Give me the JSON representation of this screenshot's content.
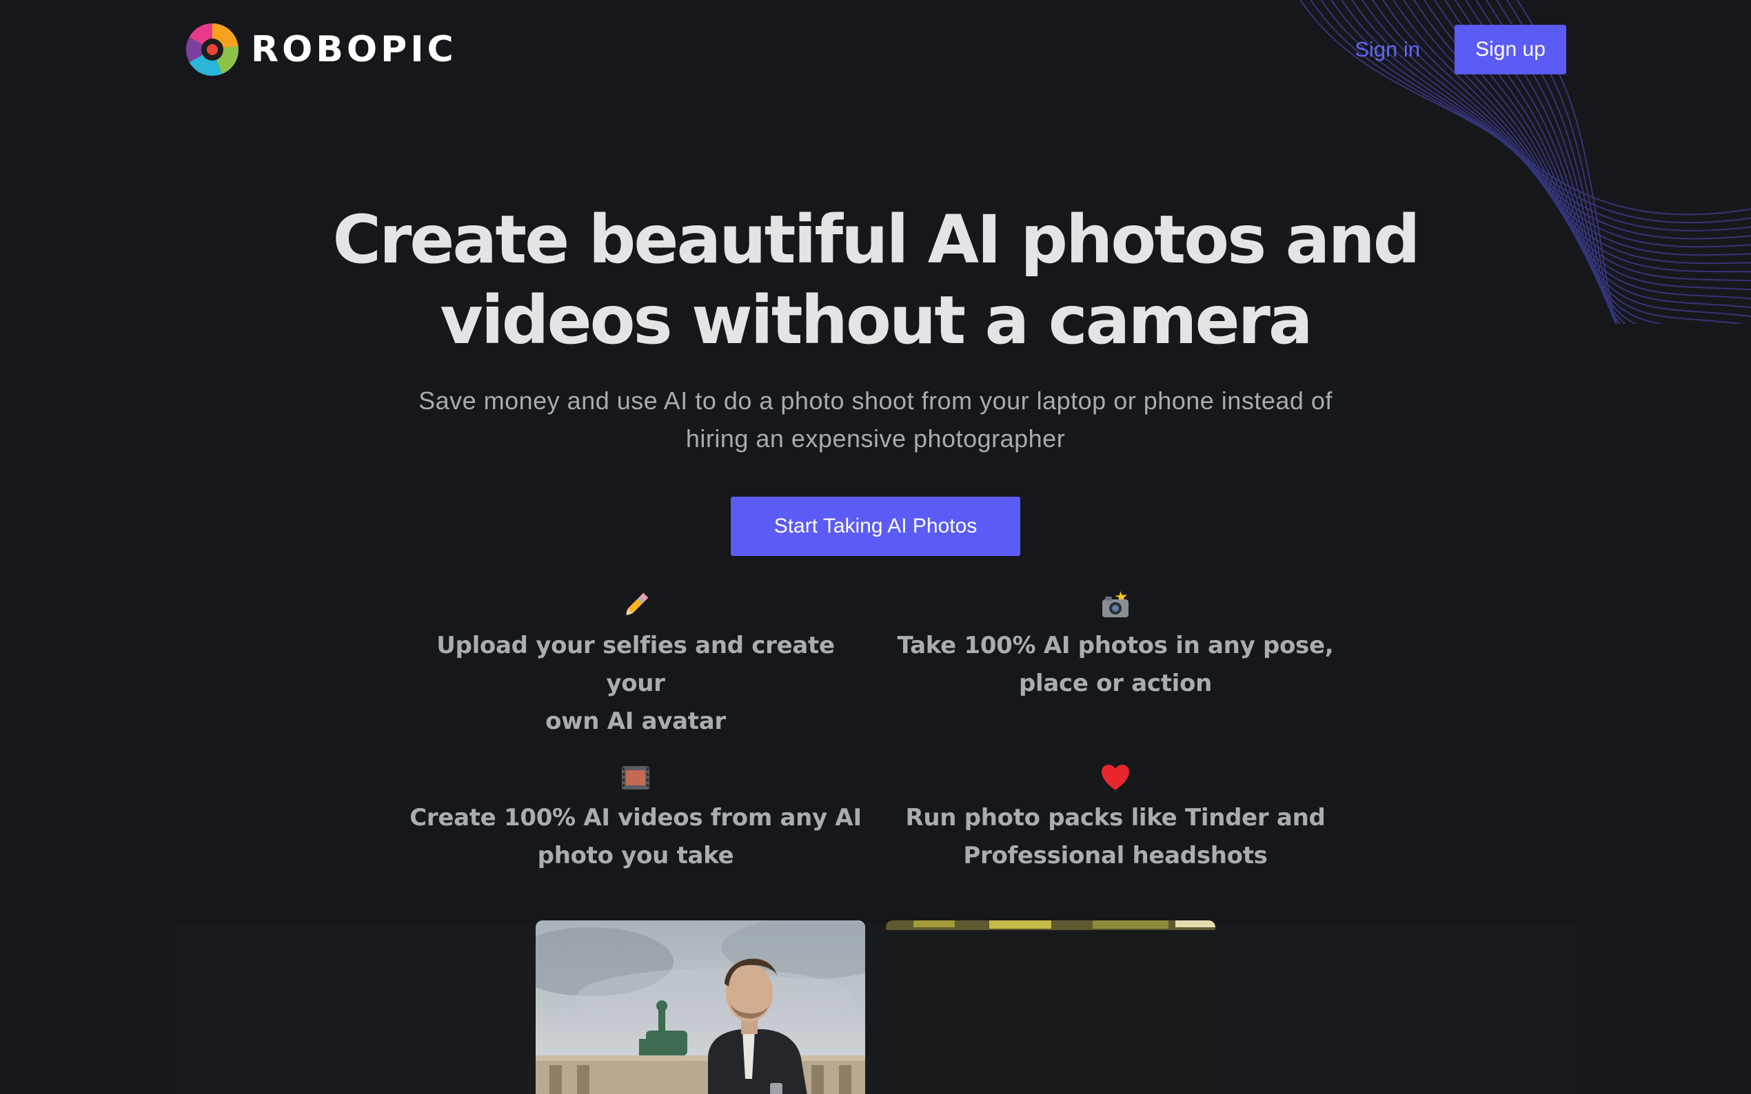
{
  "brand": {
    "name": "ROBOPIC",
    "logo_icon": "camera-aperture-logo"
  },
  "nav": {
    "signin_label": "Sign in",
    "signup_label": "Sign up"
  },
  "hero": {
    "title_line1": "Create beautiful AI photos and",
    "title_line2": "videos without a camera",
    "subtitle_line1": "Save money and use AI to do a photo shoot from your laptop or phone instead of",
    "subtitle_line2": "hiring an expensive photographer",
    "cta_label": "Start Taking AI Photos"
  },
  "features": [
    {
      "icon": "pencil-icon",
      "line1": "Upload your selfies and create your",
      "line2": "own AI avatar"
    },
    {
      "icon": "camera-flash-icon",
      "line1": "Take 100% AI photos in any pose,",
      "line2": "place or action"
    },
    {
      "icon": "film-icon",
      "line1": "Create 100% AI videos from any AI",
      "line2": "photo you take"
    },
    {
      "icon": "heart-icon",
      "line1": "Run photo packs like Tinder and",
      "line2": "Professional headshots"
    }
  ],
  "colors": {
    "background": "#16171a",
    "accent": "#5b5bf6",
    "link": "#6366f1",
    "title": "#e2e4e6",
    "muted": "#a8acb2"
  }
}
